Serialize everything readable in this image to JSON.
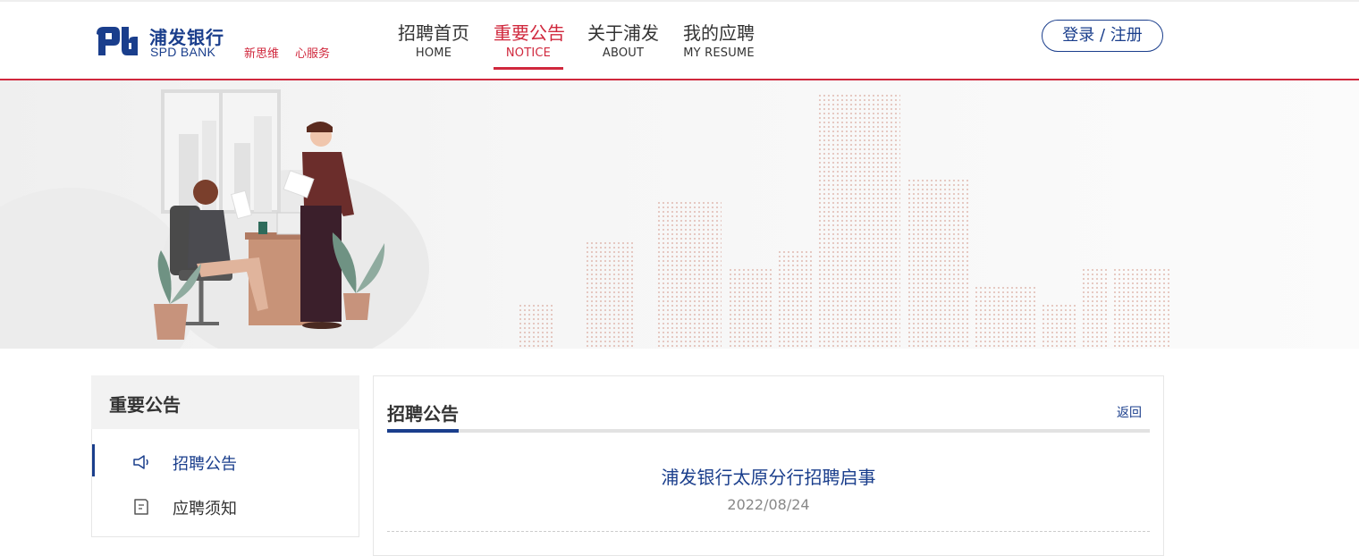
{
  "brand": {
    "name_cn": "浦发银行",
    "name_en": "SPD BANK",
    "slogan": [
      "新思维",
      "心服务"
    ],
    "logo_icon": "spdb-logo-icon",
    "colors": {
      "primary": "#1a3e8c",
      "accent": "#d0283d"
    }
  },
  "nav": {
    "items": [
      {
        "cn": "招聘首页",
        "en": "HOME",
        "active": false
      },
      {
        "cn": "重要公告",
        "en": "NOTICE",
        "active": true
      },
      {
        "cn": "关于浦发",
        "en": "ABOUT",
        "active": false
      },
      {
        "cn": "我的应聘",
        "en": "MY RESUME",
        "active": false
      }
    ],
    "login_label": "登录 / 注册"
  },
  "sidebar": {
    "title": "重要公告",
    "items": [
      {
        "label": "招聘公告",
        "icon": "megaphone-icon",
        "active": true
      },
      {
        "label": "应聘须知",
        "icon": "document-icon",
        "active": false
      }
    ]
  },
  "content": {
    "title": "招聘公告",
    "back_label": "返回",
    "article": {
      "title": "浦发银行太原分行招聘启事",
      "date": "2022/08/24"
    }
  }
}
